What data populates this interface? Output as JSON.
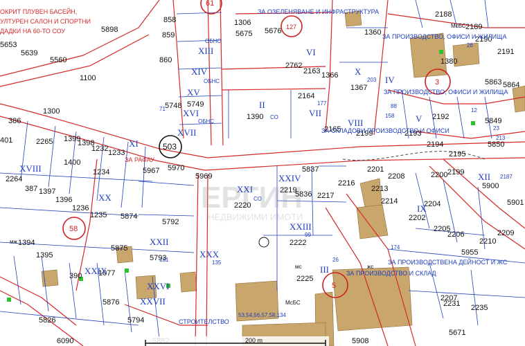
{
  "colors": {
    "background": "#ffffff",
    "road_boundary": "#d62828",
    "parcel_line": "#1f3fbf",
    "block_label": "#1f3fbf",
    "parcel_number": "#111111",
    "zone_text": "#d62828",
    "building_fill": "#c9a76c",
    "tree_marker": "#2fbf2f",
    "circle_marker": "#cc2222"
  },
  "parcel_numbers": [
    "5898",
    "5653",
    "5639",
    "5560",
    "1100",
    "858",
    "859",
    "860",
    "1306",
    "5675",
    "5676",
    "2762",
    "2163",
    "1366",
    "1367",
    "2164",
    "1360",
    "2188",
    "2189",
    "2190",
    "2191",
    "1380",
    "5863",
    "5864",
    "5748",
    "5749",
    "1390",
    "2165",
    "2199",
    "2192",
    "2193",
    "2194",
    "2195",
    "5850",
    "5849",
    "1300",
    "386",
    "401",
    "2265",
    "1399",
    "1398",
    "1232",
    "1233",
    "503",
    "5967",
    "5970",
    "5969",
    "2264",
    "1400",
    "1234",
    "387",
    "1397",
    "1396",
    "1236",
    "1235",
    "5874",
    "2220",
    "5837",
    "2219",
    "5836",
    "2217",
    "2216",
    "2201",
    "2208",
    "2213",
    "2214",
    "2200",
    "2199",
    "5900",
    "5901",
    "5792",
    "1394",
    "1395",
    "5875",
    "1077",
    "390",
    "5793",
    "2222",
    "2204",
    "2202",
    "2205",
    "2206",
    "2210",
    "5955",
    "2209",
    "5876",
    "5826",
    "2225",
    "2207",
    "2231",
    "2235",
    "5671",
    "5882",
    "5908",
    "6090",
    "5794"
  ],
  "block_labels": [
    "XIII",
    "XIV",
    "XV",
    "XVI",
    "XVII",
    "II",
    "VII",
    "VIII",
    "VI",
    "X",
    "IV",
    "V",
    "XII",
    "IX",
    "XI",
    "XVIII",
    "XX",
    "XXI",
    "XXII",
    "XXIII",
    "XXIV",
    "III",
    "XXVI",
    "XXVII",
    "XXIX",
    "XXX"
  ],
  "zone_labels": {
    "top_center": "ЗА ОЗЕЛЕНЯВАНЕ И ИНФРАСТРУКТУРА",
    "top_right": "ЗА ПРОИЗВОДСТВО, ОФИСИ И ЖИЛИЩА",
    "right_mid": "ЗА ПРОИЗВОДСТВО, ОФИСИ И ЖИЛИЩА",
    "center": "ЗА СКЛАДОВИ ПРОИЗВОДСТВО И ОФИСИ",
    "left_top_1": "ОКРИТ ПЛУВЕН БАСЕЙН,",
    "left_top_2": "УЛТУРЕН САЛОН И СПОРТНИ",
    "left_top_3": "ДАДКИ НА 60-ТО СОУ",
    "bottom_mid": "ЗА ПРОИЗВОДСТВО И СКЛАД",
    "bottom_right": "ЗА ПРОИЗВОДСТВЕНА ДЕЙНОСТ И ЖС",
    "bottom_left": "СТРОИТЕЛСТВО",
    "rafau": "ЗА РАФАУ"
  },
  "small_codes": [
    "ОБНС",
    "СО",
    "МсБС",
    "жс",
    "мс",
    "мж"
  ],
  "circle_markers": [
    {
      "label": "61"
    },
    {
      "label": "127"
    },
    {
      "label": "503"
    },
    {
      "label": "58"
    },
    {
      "label": "3"
    },
    {
      "label": "5"
    }
  ],
  "misc_numbers": [
    "203",
    "177",
    "158",
    "28",
    "23",
    "213",
    "2187",
    "174",
    "71",
    "135",
    "99",
    "26",
    "88",
    "12",
    "131"
  ],
  "address_label": "53,54,56,57,58,134",
  "scale_label": "200 m",
  "watermark": {
    "line1": "ЕРГИН",
    "line2": "НЕДВИЖИМИ ИМОТИ"
  }
}
